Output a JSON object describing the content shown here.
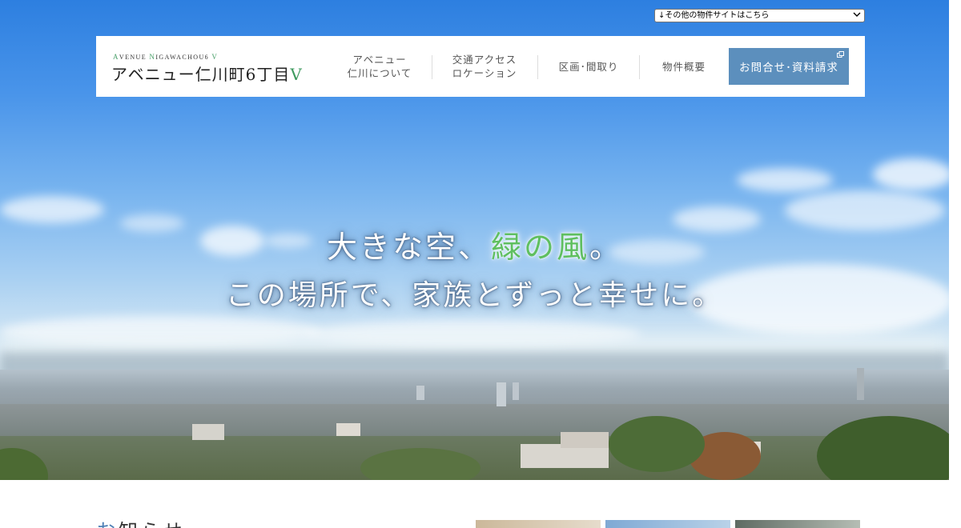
{
  "site_select": {
    "label": "↓その他の物件サイトはこちら"
  },
  "logo": {
    "small_parts": [
      "A",
      "VENUE ",
      "N",
      "IGAWACHOU6 ",
      "V"
    ],
    "main": "アベニュー仁川町6丁目",
    "main_suffix": "V"
  },
  "nav": {
    "items": [
      {
        "label": "アベニュー\n仁川について"
      },
      {
        "label": "交通アクセス\nロケーション"
      },
      {
        "label": "区画･間取り"
      },
      {
        "label": "物件概要"
      }
    ],
    "contact_label": "お問合せ･資料請求"
  },
  "hero": {
    "catch_line1_a": "大きな空、",
    "catch_line1_b": "緑の風",
    "catch_line1_c": "。",
    "catch_line2": "この場所で、家族とずっと幸せに。"
  },
  "news": {
    "title_first": "お",
    "title_rest": "知らせ"
  },
  "colors": {
    "accent_blue": "#5c8fbd",
    "logo_green": "#3d9a5e",
    "catch_green": "#5fbf60"
  },
  "icons": {
    "external": "external-link-icon",
    "select": "chevron-down-icon"
  }
}
